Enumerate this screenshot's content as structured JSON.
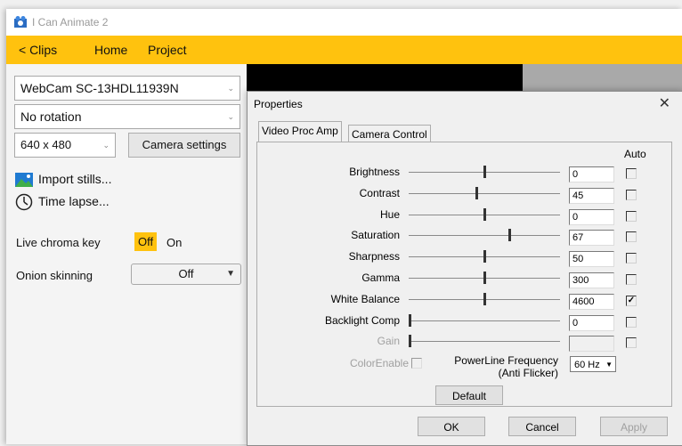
{
  "app": {
    "title": "I Can Animate 2",
    "nav": {
      "clips": "< Clips",
      "home": "Home",
      "project": "Project"
    }
  },
  "left_panel": {
    "camera": "WebCam SC-13HDL11939N",
    "rotation": "No rotation",
    "resolution": "640 x 480",
    "camera_settings": "Camera settings",
    "import_stills": "Import stills...",
    "time_lapse": "Time lapse...",
    "live_chroma_key": "Live chroma key",
    "chroma_off": "Off",
    "chroma_on": "On",
    "onion_skinning": "Onion skinning",
    "onion_value": "Off"
  },
  "dialog": {
    "title": "Properties",
    "tabs": [
      "Video Proc Amp",
      "Camera Control"
    ],
    "auto_label": "Auto",
    "rows": [
      {
        "label": "Brightness",
        "value": "0",
        "level": 0.5,
        "auto": false,
        "disabled": false
      },
      {
        "label": "Contrast",
        "value": "45",
        "level": 0.45,
        "auto": false,
        "disabled": false
      },
      {
        "label": "Hue",
        "value": "0",
        "level": 0.5,
        "auto": false,
        "disabled": false
      },
      {
        "label": "Saturation",
        "value": "67",
        "level": 0.67,
        "auto": false,
        "disabled": false
      },
      {
        "label": "Sharpness",
        "value": "50",
        "level": 0.5,
        "auto": false,
        "disabled": false
      },
      {
        "label": "Gamma",
        "value": "300",
        "level": 0.5,
        "auto": false,
        "disabled": false
      },
      {
        "label": "White Balance",
        "value": "4600",
        "level": 0.5,
        "auto": true,
        "disabled": false
      },
      {
        "label": "Backlight Comp",
        "value": "0",
        "level": 0.0,
        "auto": false,
        "disabled": false
      },
      {
        "label": "Gain",
        "value": "",
        "level": 0.0,
        "auto": false,
        "disabled": true
      }
    ],
    "color_enable": "ColorEnable",
    "powerline_label": "PowerLine Frequency",
    "powerline_sub": "(Anti Flicker)",
    "powerline_value": "60 Hz",
    "default_btn": "Default",
    "ok_btn": "OK",
    "cancel_btn": "Cancel",
    "apply_btn": "Apply"
  },
  "colors": {
    "nav_bg": "#ffc20e",
    "chroma_off_bg": "#ffc20e"
  }
}
